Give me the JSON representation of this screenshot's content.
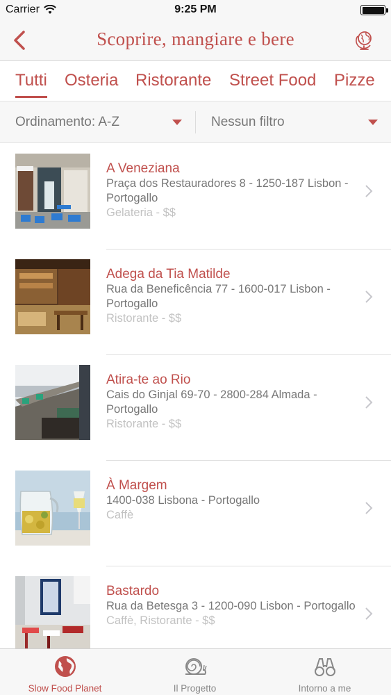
{
  "status_bar": {
    "carrier": "Carrier",
    "time": "9:25 PM"
  },
  "nav": {
    "title": "Scoprire, mangiare e bere",
    "back_icon": "chevron-left-icon",
    "right_icon": "globe-icon"
  },
  "tabs": [
    {
      "label": "Tutti",
      "active": true
    },
    {
      "label": "Osteria"
    },
    {
      "label": "Ristorante"
    },
    {
      "label": "Street Food"
    },
    {
      "label": "Pizze"
    }
  ],
  "filters": {
    "sort_label": "Ordinamento: A-Z",
    "filter_label": "Nessun filtro"
  },
  "places": [
    {
      "name": "A Veneziana",
      "address": "Praça dos Restauradores 8 - 1250-187 Lisbon - Portogallo",
      "category": "Gelateria - $$"
    },
    {
      "name": "Adega da Tia Matilde",
      "address": "Rua da Beneficência 77 - 1600-017 Lisbon - Portogallo",
      "category": "Ristorante - $$"
    },
    {
      "name": "Atira-te ao Rio",
      "address": "Cais do Ginjal 69-70 - 2800-284 Almada - Portogallo",
      "category": "Ristorante - $$"
    },
    {
      "name": "À Margem",
      "address": "1400-038 Lisbona - Portogallo",
      "category": "Caffè"
    },
    {
      "name": "Bastardo",
      "address": "Rua da Betesga 3 - 1200-090  Lisbon - Portogallo",
      "category": "Caffè, Ristorante - $$"
    }
  ],
  "tab_bar": [
    {
      "label": "Slow Food Planet",
      "icon": "globe-icon",
      "active": true
    },
    {
      "label": "Il Progetto",
      "icon": "snail-icon"
    },
    {
      "label": "Intorno a me",
      "icon": "binoculars-icon"
    }
  ],
  "colors": {
    "accent": "#c0504d",
    "bar_bg": "#f7f7f7",
    "muted": "#777777",
    "faint": "#c2c2c2"
  }
}
